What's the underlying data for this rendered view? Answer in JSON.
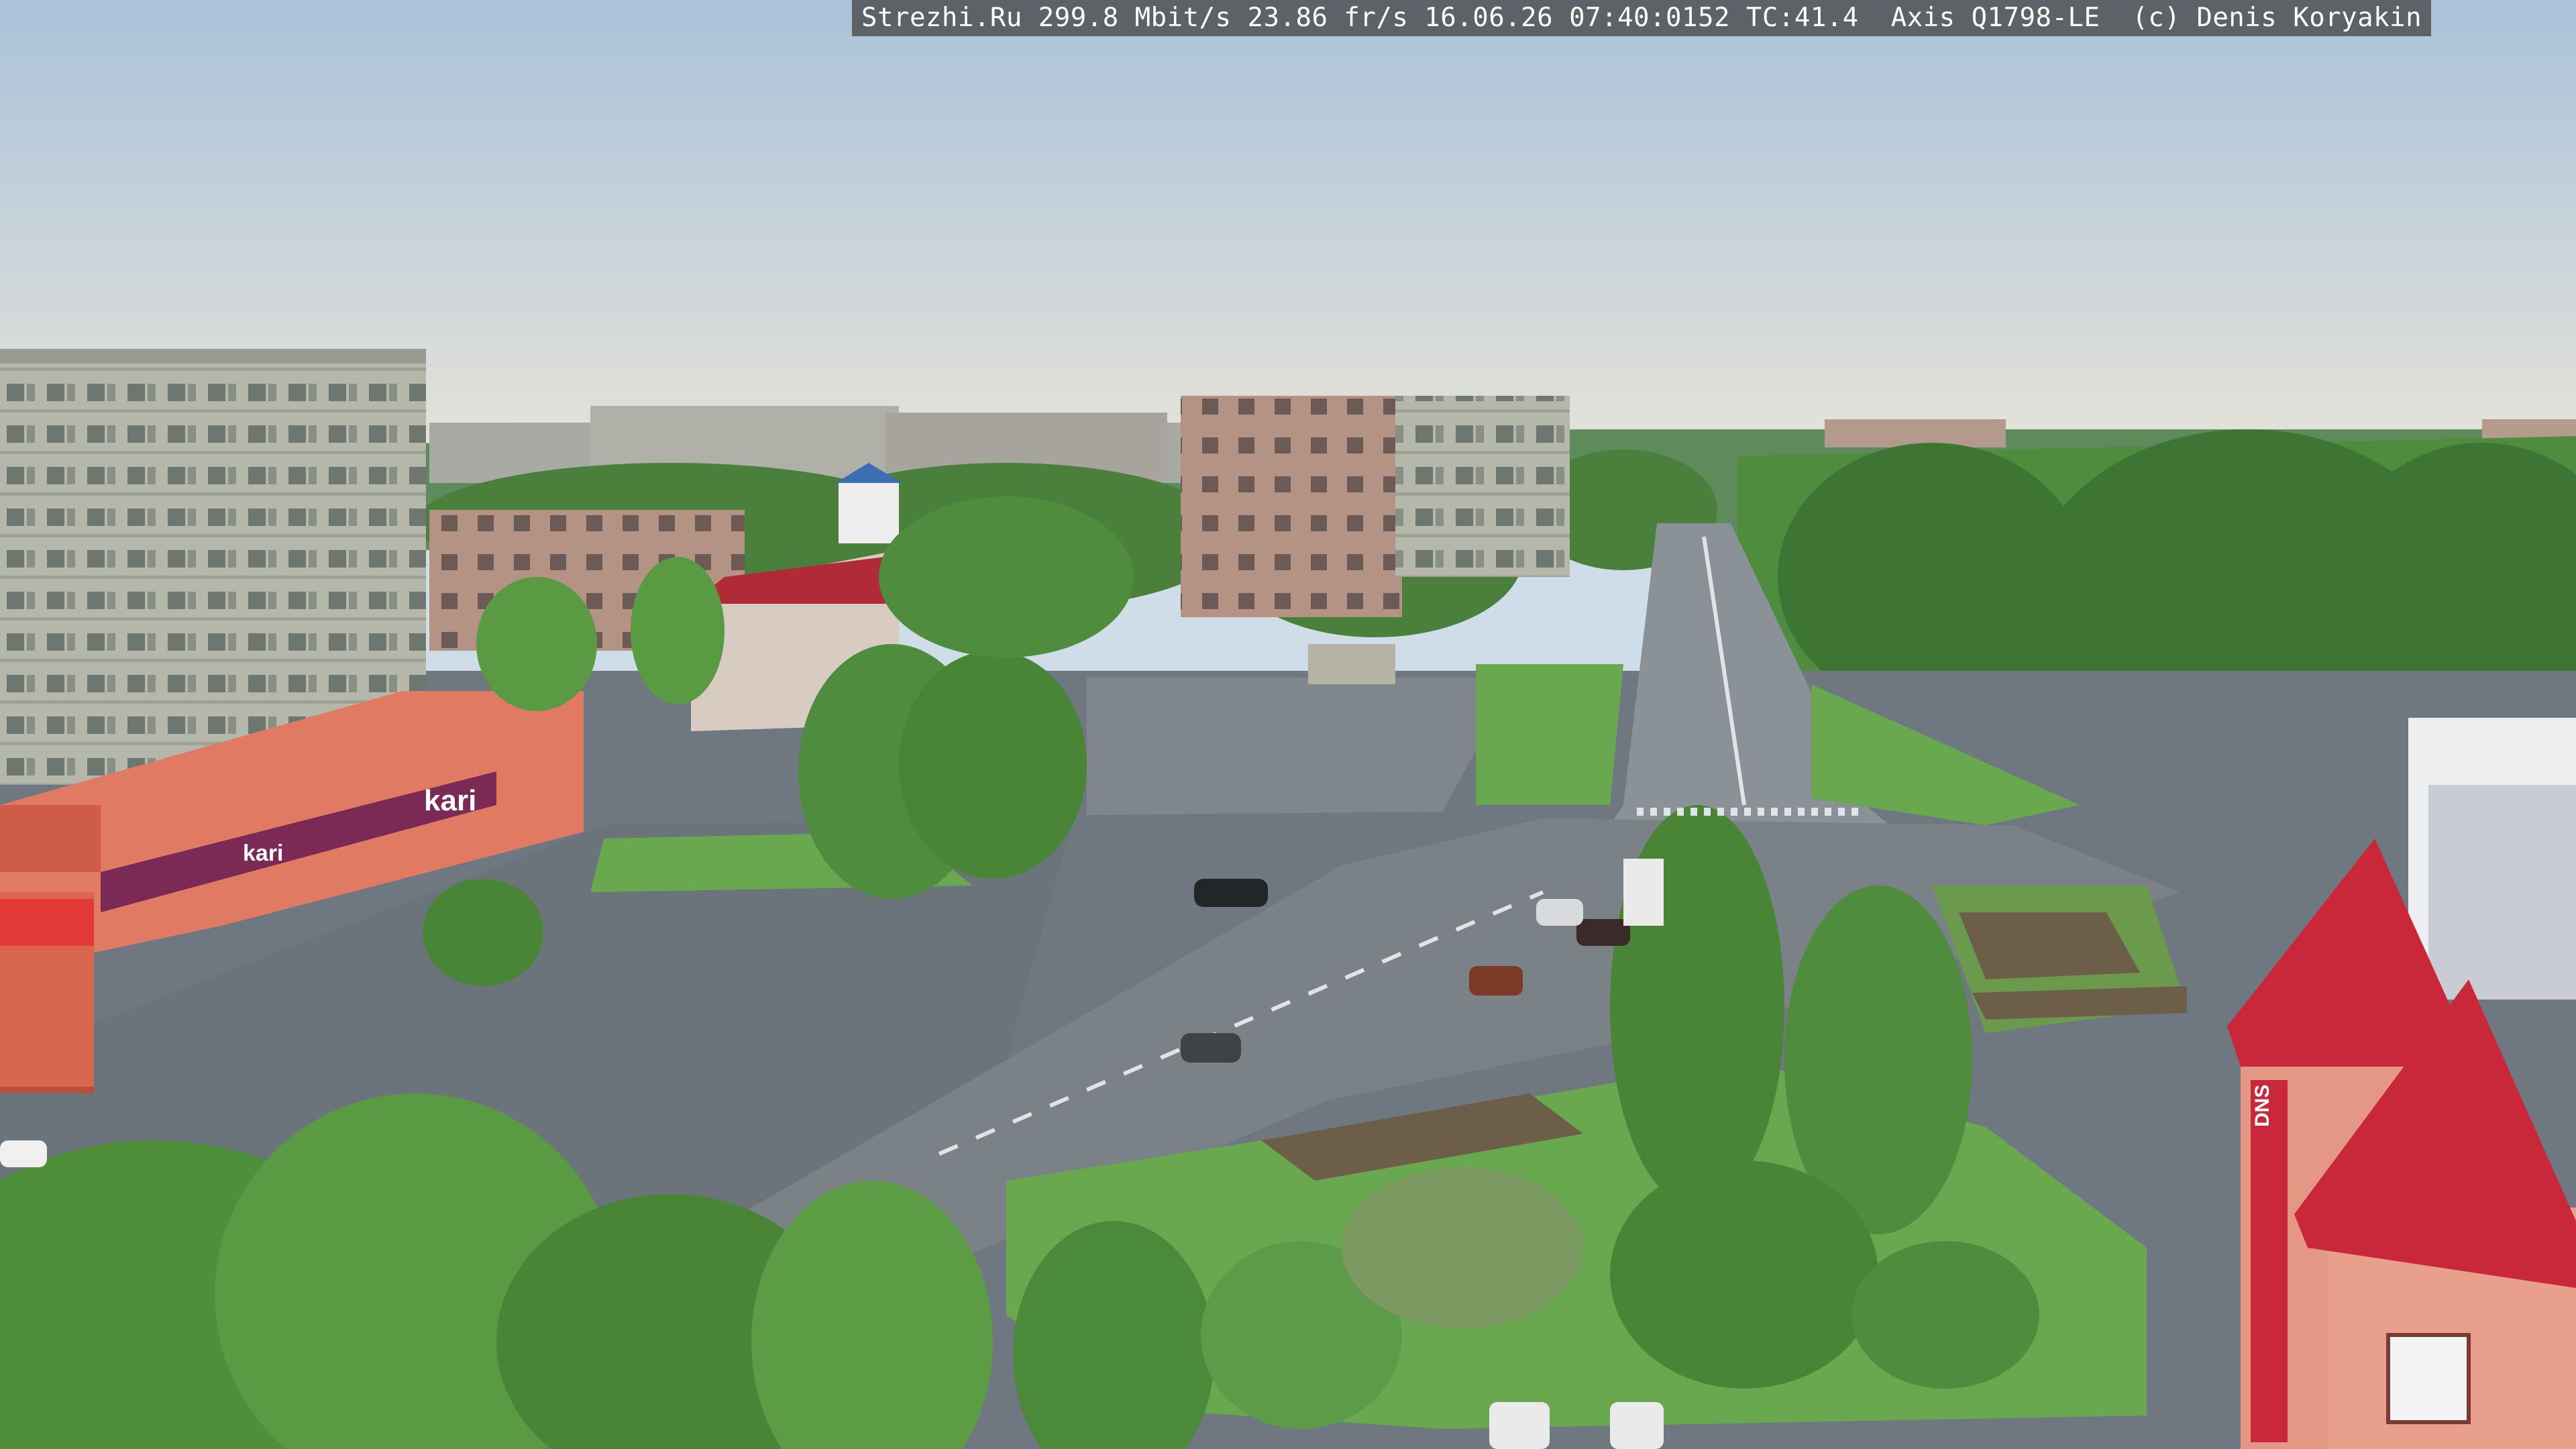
{
  "camera_overlay": {
    "text": "Strezhi.Ru 299.8 Mbit/s 23.86 fr/s 16.06.26 07:40:0152 TC:41.4  Axis Q1798-LE  (c) Denis Koryakin"
  },
  "signage": {
    "store_sign": "kari",
    "store_sign_small": "kari",
    "tower_sign": "DNS"
  },
  "colors": {
    "sky_top": "#a9c2da",
    "sky_horizon": "#e6e3d9",
    "foliage": "#4f8f3a",
    "lawn": "#6aa84f",
    "asphalt": "#707880",
    "shop_facade": "#e07a62",
    "roof_red": "#c8283a",
    "panel_building": "#b7b9ad"
  }
}
